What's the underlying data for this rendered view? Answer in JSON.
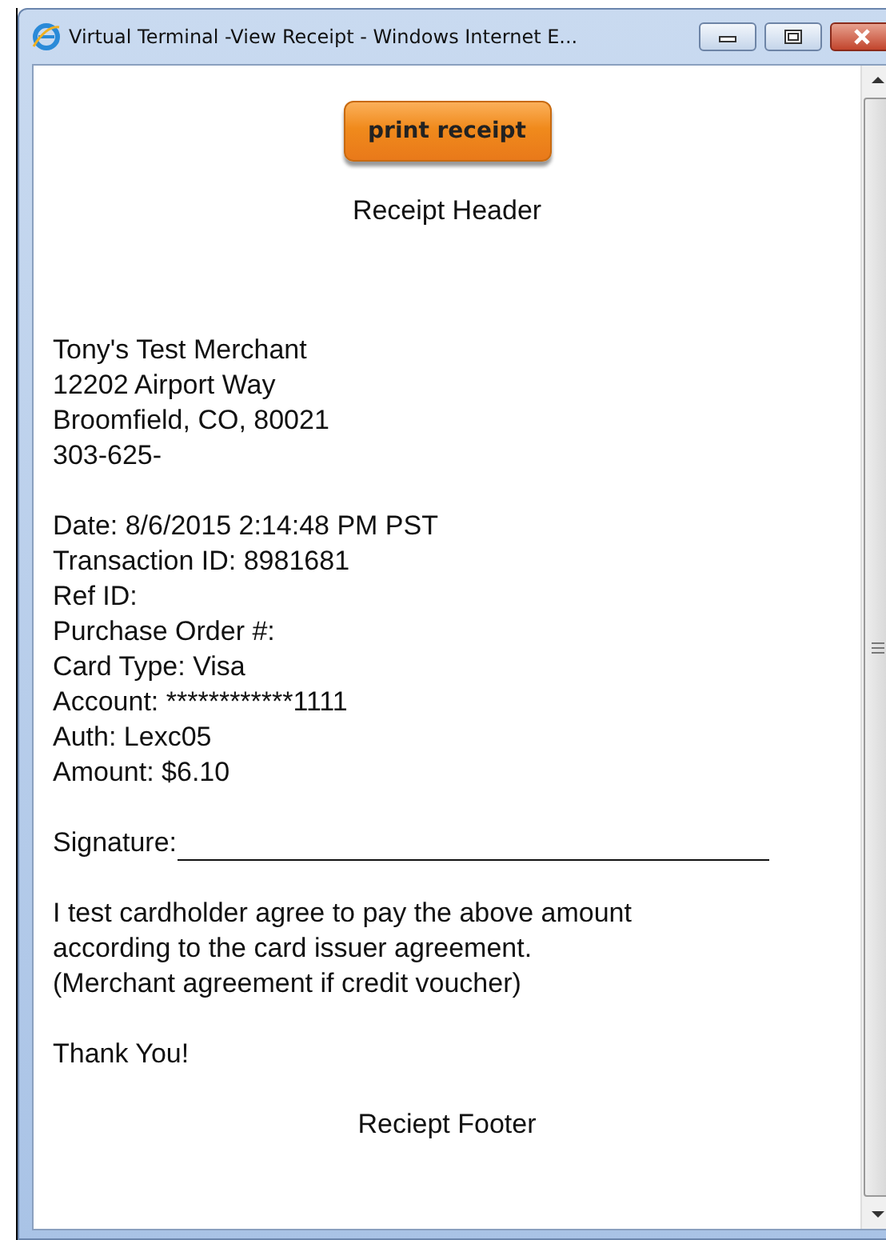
{
  "window": {
    "title": "Virtual Terminal -View Receipt - Windows Internet E..."
  },
  "print_button": {
    "label": "print receipt"
  },
  "header": "Receipt Header",
  "blocks": [
    {
      "kind": "lines",
      "lines": [
        "Tony's Test Merchant",
        "12202 Airport Way",
        "Broomfield, CO, 80021",
        "303-625-"
      ]
    },
    {
      "kind": "lines",
      "lines": [
        "Date: 8/6/2015 2:14:48 PM PST",
        "Transaction ID: 8981681",
        "Ref ID:",
        "Purchase Order #:",
        "Card Type: Visa",
        "Account: ************1111",
        "Auth: Lexc05",
        "Amount: $6.10"
      ]
    },
    {
      "kind": "signature",
      "label": "Signature:"
    },
    {
      "kind": "lines",
      "lines": [
        "I test cardholder agree to pay the above amount",
        "according to the card issuer agreement.",
        "(Merchant agreement if credit voucher)"
      ]
    },
    {
      "kind": "lines",
      "lines": [
        "Thank You!"
      ]
    }
  ],
  "footer": "Reciept Footer"
}
